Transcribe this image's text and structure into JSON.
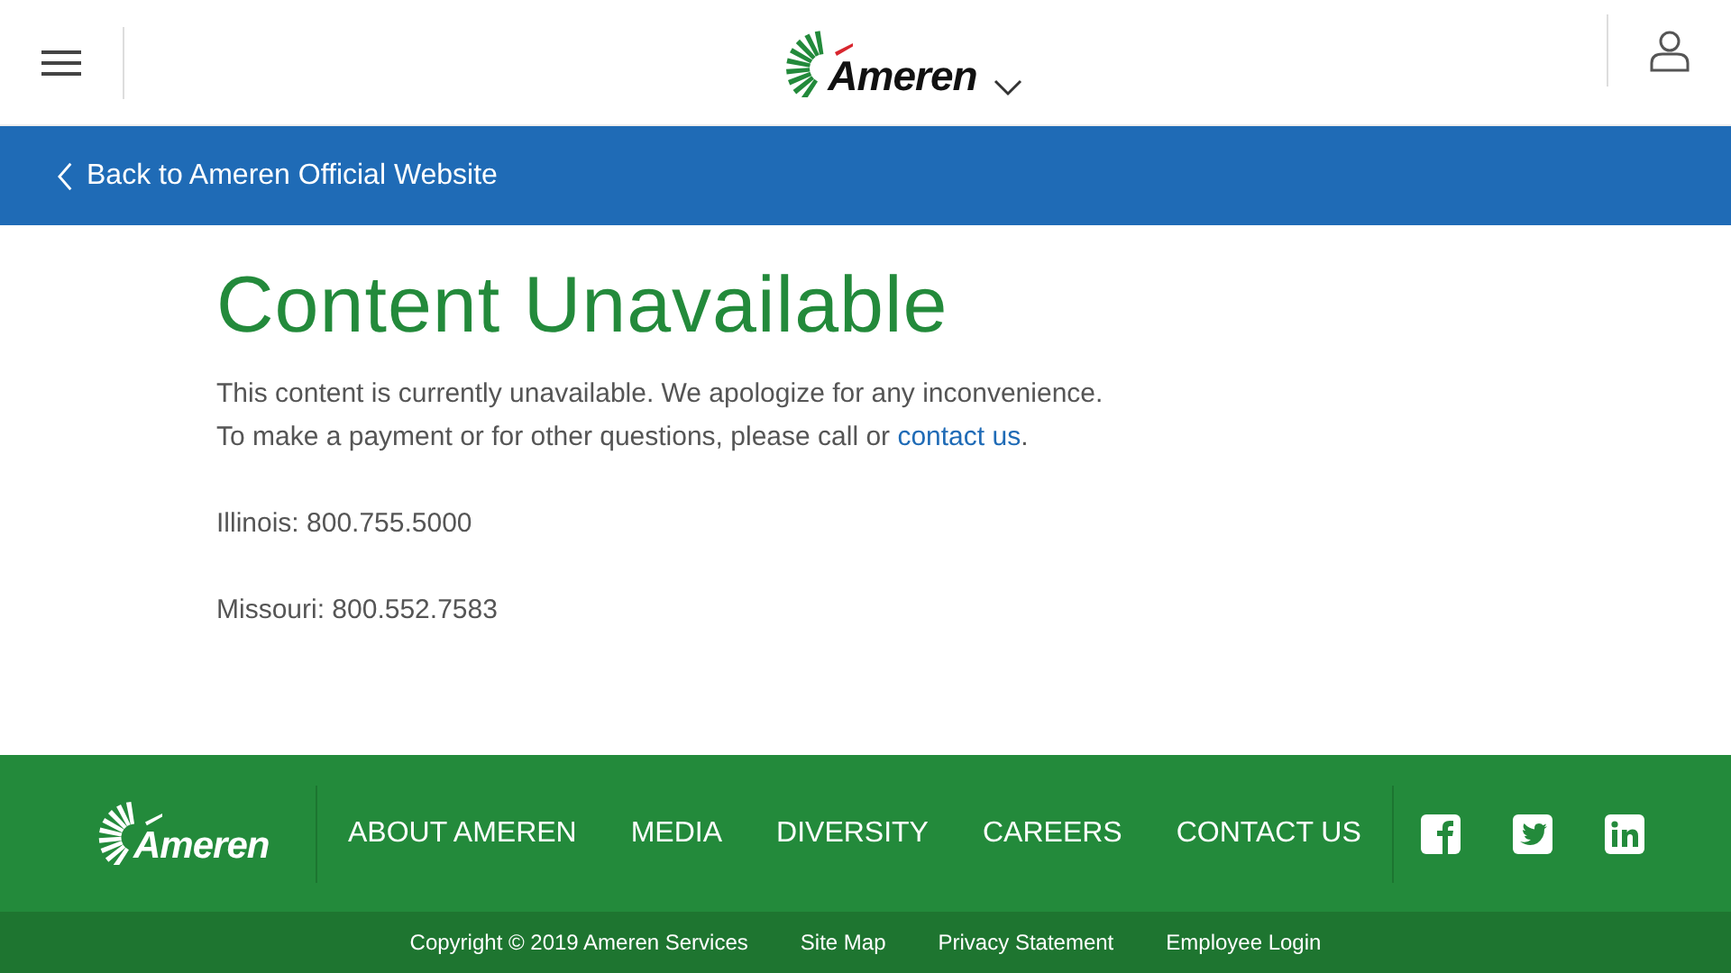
{
  "header": {
    "logo": "Ameren"
  },
  "back_link": "Back to Ameren Official Website",
  "content": {
    "title": "Content Unavailable",
    "lines": [
      {
        "text": "This content is currently unavailable. We apologize for any inconvenience."
      },
      {
        "text": "To make a payment or for other questions, please call or ",
        "link": "contact us",
        "after": "."
      }
    ],
    "phones": [
      "Illinois: 800.755.5000",
      "Missouri: 800.552.7583"
    ]
  },
  "footer": {
    "logo": "Ameren",
    "nav": [
      "ABOUT AMEREN",
      "MEDIA",
      "DIVERSITY",
      "CAREERS",
      "CONTACT US"
    ],
    "social": [
      {
        "kind": "facebook"
      },
      {
        "kind": "twitter"
      },
      {
        "kind": "linkedin"
      }
    ],
    "copyright": "Copyright © 2019 Ameren Services",
    "links": [
      "Site Map",
      "Privacy Statement",
      "Employee Login"
    ]
  }
}
